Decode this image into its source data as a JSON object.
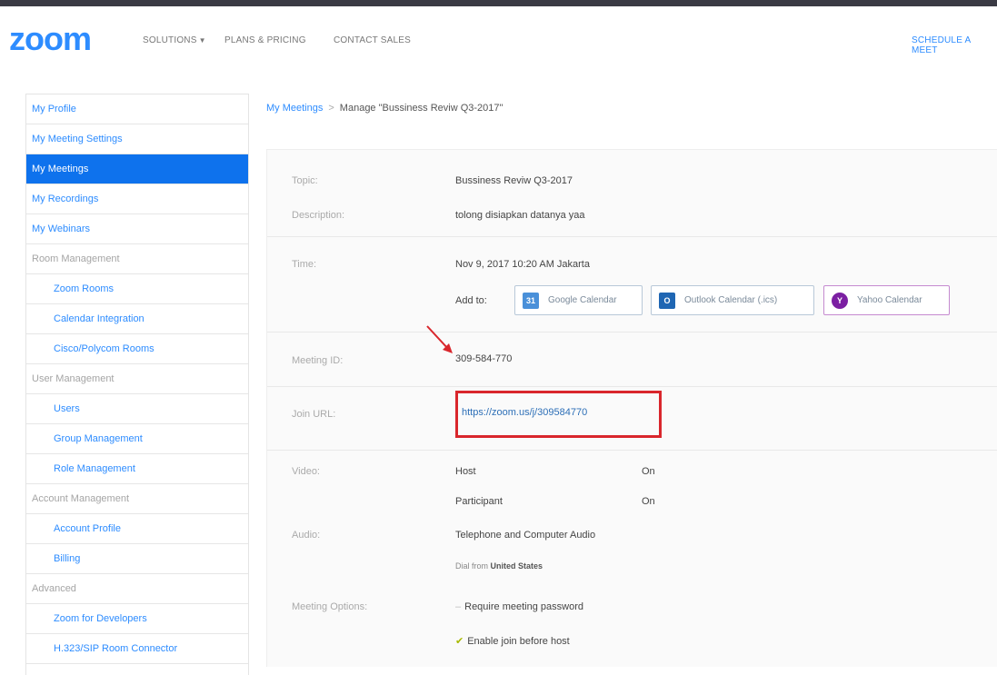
{
  "header": {
    "logo": "zoom",
    "nav": {
      "solutions": "SOLUTIONS",
      "plans": "PLANS & PRICING",
      "contact": "CONTACT SALES",
      "schedule": "SCHEDULE A MEET"
    }
  },
  "sidebar": {
    "items": [
      {
        "label": "My Profile",
        "type": "link"
      },
      {
        "label": "My Meeting Settings",
        "type": "link"
      },
      {
        "label": "My Meetings",
        "type": "active"
      },
      {
        "label": "My Recordings",
        "type": "link"
      },
      {
        "label": "My Webinars",
        "type": "link"
      },
      {
        "label": "Room Management",
        "type": "section"
      },
      {
        "label": "Zoom Rooms",
        "type": "sub"
      },
      {
        "label": "Calendar Integration",
        "type": "sub"
      },
      {
        "label": "Cisco/Polycom Rooms",
        "type": "sub"
      },
      {
        "label": "User Management",
        "type": "section"
      },
      {
        "label": "Users",
        "type": "sub"
      },
      {
        "label": "Group Management",
        "type": "sub"
      },
      {
        "label": "Role Management",
        "type": "sub"
      },
      {
        "label": "Account Management",
        "type": "section"
      },
      {
        "label": "Account Profile",
        "type": "sub"
      },
      {
        "label": "Billing",
        "type": "sub"
      },
      {
        "label": "Advanced",
        "type": "section"
      },
      {
        "label": "Zoom for Developers",
        "type": "sub"
      },
      {
        "label": "H.323/SIP Room Connector",
        "type": "sub"
      }
    ]
  },
  "breadcrumb": {
    "parent": "My Meetings",
    "separator": ">",
    "current": "Manage \"Bussiness Reviw Q3-2017\""
  },
  "meeting": {
    "topic_label": "Topic:",
    "topic": "Bussiness Reviw Q3-2017",
    "description_label": "Description:",
    "description": "tolong disiapkan datanya yaa",
    "time_label": "Time:",
    "time": "Nov 9, 2017 10:20 AM Jakarta",
    "add_to_label": "Add to:",
    "calendars": {
      "google": "Google Calendar",
      "outlook": "Outlook Calendar (.ics)",
      "yahoo": "Yahoo Calendar"
    },
    "meeting_id_label": "Meeting ID:",
    "meeting_id": "309-584-770",
    "join_url_label": "Join URL:",
    "join_url": "https://zoom.us/j/309584770",
    "video_label": "Video:",
    "host_label": "Host",
    "host_value": "On",
    "participant_label": "Participant",
    "participant_value": "On",
    "audio_label": "Audio:",
    "audio": "Telephone and Computer Audio",
    "dial_prefix": "Dial from",
    "dial_country": "United States",
    "options_label": "Meeting Options:",
    "option_password": "Require meeting password",
    "option_join_before": "Enable join before host"
  },
  "colors": {
    "brand": "#2d8cff",
    "active": "#0e72ed",
    "highlight_box": "#d9262c",
    "annotation_arrow": "#d9262c"
  }
}
